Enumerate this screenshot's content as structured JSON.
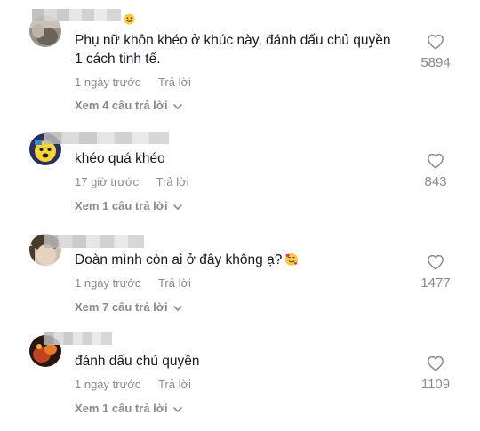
{
  "comments": [
    {
      "text": "Phụ nữ khôn khéo ở khúc này, đánh dấu chủ quyền",
      "text_line2": "1 cách tinh tế.",
      "time": "1 ngày trước",
      "reply_label": "Trả lời",
      "view_replies": "Xem 4 câu trả lời",
      "likes": "5894"
    },
    {
      "text": "khéo quá khéo",
      "time": "17 giờ trước",
      "reply_label": "Trả lời",
      "view_replies": "Xem 1 câu trả lời",
      "likes": "843"
    },
    {
      "text": "Đoàn mình còn ai ở đây không ạ?",
      "time": "1 ngày trước",
      "reply_label": "Trả lời",
      "view_replies": "Xem 7 câu trả lời",
      "likes": "1477"
    },
    {
      "text": "đánh dấu chủ quyền",
      "time": "1 ngày trước",
      "reply_label": "Trả lời",
      "view_replies": "Xem 1 câu trả lời",
      "likes": "1109"
    }
  ],
  "icons": {
    "like": "heart-outline-icon",
    "expand": "chevron-down-icon",
    "emoji_1": "smiling-face-emoji",
    "emoji_3": "smiling-face-with-hearts-emoji"
  },
  "colors": {
    "text": "#161823",
    "muted": "#8a8b91",
    "background": "#ffffff"
  }
}
